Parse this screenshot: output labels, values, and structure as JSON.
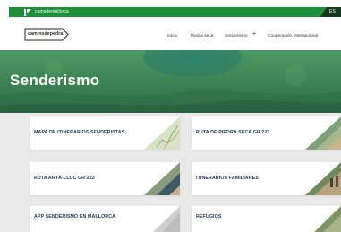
{
  "topbar": {
    "brand": "camsdemallorca",
    "lang": "ES"
  },
  "navbar": {
    "logo": "caminsdepedra",
    "items": [
      {
        "label": "Inicio"
      },
      {
        "label": "Piedra seca"
      },
      {
        "label": "Senderismo"
      },
      {
        "label": "Cooperación Internacional"
      }
    ],
    "expand_symbol": "+"
  },
  "hero": {
    "title": "Senderismo"
  },
  "cards": [
    {
      "label": "MAPA DE ITINERARIOS SENDERISTAS",
      "icon": "map-thumbnail"
    },
    {
      "label": "RUTA DE PIEDRA SECA GR 221",
      "icon": "landscape-thumbnail"
    },
    {
      "label": "RUTA ARTÀ-LLUC GR 222",
      "icon": "landscape-thumbnail"
    },
    {
      "label": "ITINERARIOS FAMILIARES",
      "icon": "landscape-thumbnail"
    },
    {
      "label": "APP SENDERISMO EN MALLORCA",
      "icon": "phone-thumbnail"
    },
    {
      "label": "REFUGIOS",
      "icon": "landscape-thumbnail"
    }
  ],
  "colors": {
    "brand_green": "#1f8f3a",
    "card_title": "#1b3554",
    "background": "#e9e9e9"
  }
}
